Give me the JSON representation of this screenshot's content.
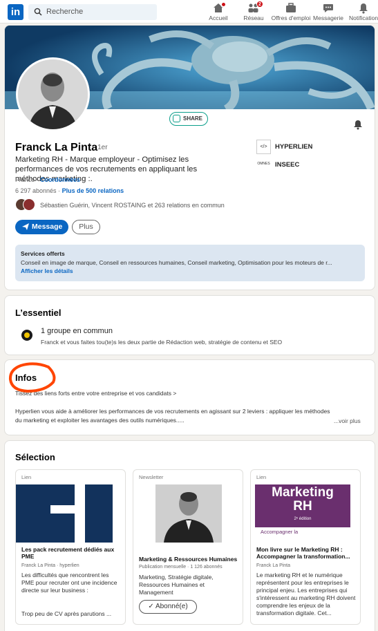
{
  "nav": {
    "logo": "in",
    "search_placeholder": "Recherche",
    "items": [
      {
        "label": "Accueil",
        "icon": "home-icon",
        "badge": ""
      },
      {
        "label": "Réseau",
        "icon": "network-icon",
        "badge": "2"
      },
      {
        "label": "Offres d'emploi",
        "icon": "briefcase-icon",
        "badge": ""
      },
      {
        "label": "Messagerie",
        "icon": "message-icon",
        "badge": ""
      },
      {
        "label": "Notifications",
        "icon": "bell-icon",
        "badge": ""
      }
    ]
  },
  "profile": {
    "share_badge": "SHARE",
    "name": "Franck La Pinta",
    "degree": "· 1er",
    "headline": "Marketing RH - Marque employeur - Optimisez les performances de vos recrutements en appliquant les méthodes marketing :.",
    "location": "France ·",
    "contact_link": "Coordonnées",
    "followers": "6 297 abonnés ·",
    "relations_link": "Plus de 500 relations",
    "mutual": "Sébastien Guérin, Vincent ROSTAING et 263 relations en commun",
    "message_button": "Message",
    "more_button": "Plus",
    "companies": [
      {
        "name": "HYPERLIEN",
        "logo_text": "</>"
      },
      {
        "name": "INSEEC",
        "logo_text": "OMNES"
      }
    ],
    "services": {
      "title": "Services offerts",
      "text": "Conseil en image de marque, Conseil en ressources humaines, Conseil marketing, Optimisation pour les moteurs de r...",
      "link": "Afficher les détails"
    }
  },
  "essentiel": {
    "title": "L’essentiel",
    "group_title": "1 groupe en commun",
    "group_sub": "Franck et vous faites tou(te)s les deux partie de Rédaction web, stratégie de contenu et SEO"
  },
  "infos": {
    "title": "Infos",
    "line1": "Tissez des liens forts entre votre entreprise et vos candidats >",
    "line2": "Hyperlien vous aide à améliorer les performances de vos recrutements en agissant sur 2 leviers : appliquer les méthodes",
    "line3": "du marketing et exploiter les avantages des outils numériques.....",
    "see_more": "...voir plus"
  },
  "selection": {
    "title": "Sélection",
    "cards": [
      {
        "type": "Lien",
        "title": "Les pack recrutement dédiés aux PME",
        "sub": "Franck La Pinta · hyperlien",
        "desc": "Les difficultés que rencontrent les PME pour recruter ont une incidence directe sur leur business :",
        "desc2": "Trop peu de CV après parutions ..."
      },
      {
        "type": "Newsletter",
        "title": "Marketing & Ressources Humaines",
        "sub": "Publication mensuelle · 1 126 abonnés",
        "desc": "Marketing, Stratégie digitale, Ressources Humaines et Management",
        "button": "Abonné(e)"
      },
      {
        "type": "Lien",
        "title": "Mon livre sur le Marketing RH : Accompagner la transformation...",
        "sub": "Franck La Pinta",
        "desc": "Le marketing RH et le numérique représentent pour les entreprises le principal enjeu. Les entreprises qui s'intéressent au marketing RH doivent comprendre les enjeux de la transformation digitale. Cet...",
        "book_title": "Marketing",
        "book_title2": "RH",
        "book_edition": "2ᵉ édition",
        "book_sub": "Accompagner la"
      }
    ]
  },
  "colors": {
    "brand": "#0a66c2",
    "badge": "#cc1016",
    "annotation": "#ff4500"
  }
}
